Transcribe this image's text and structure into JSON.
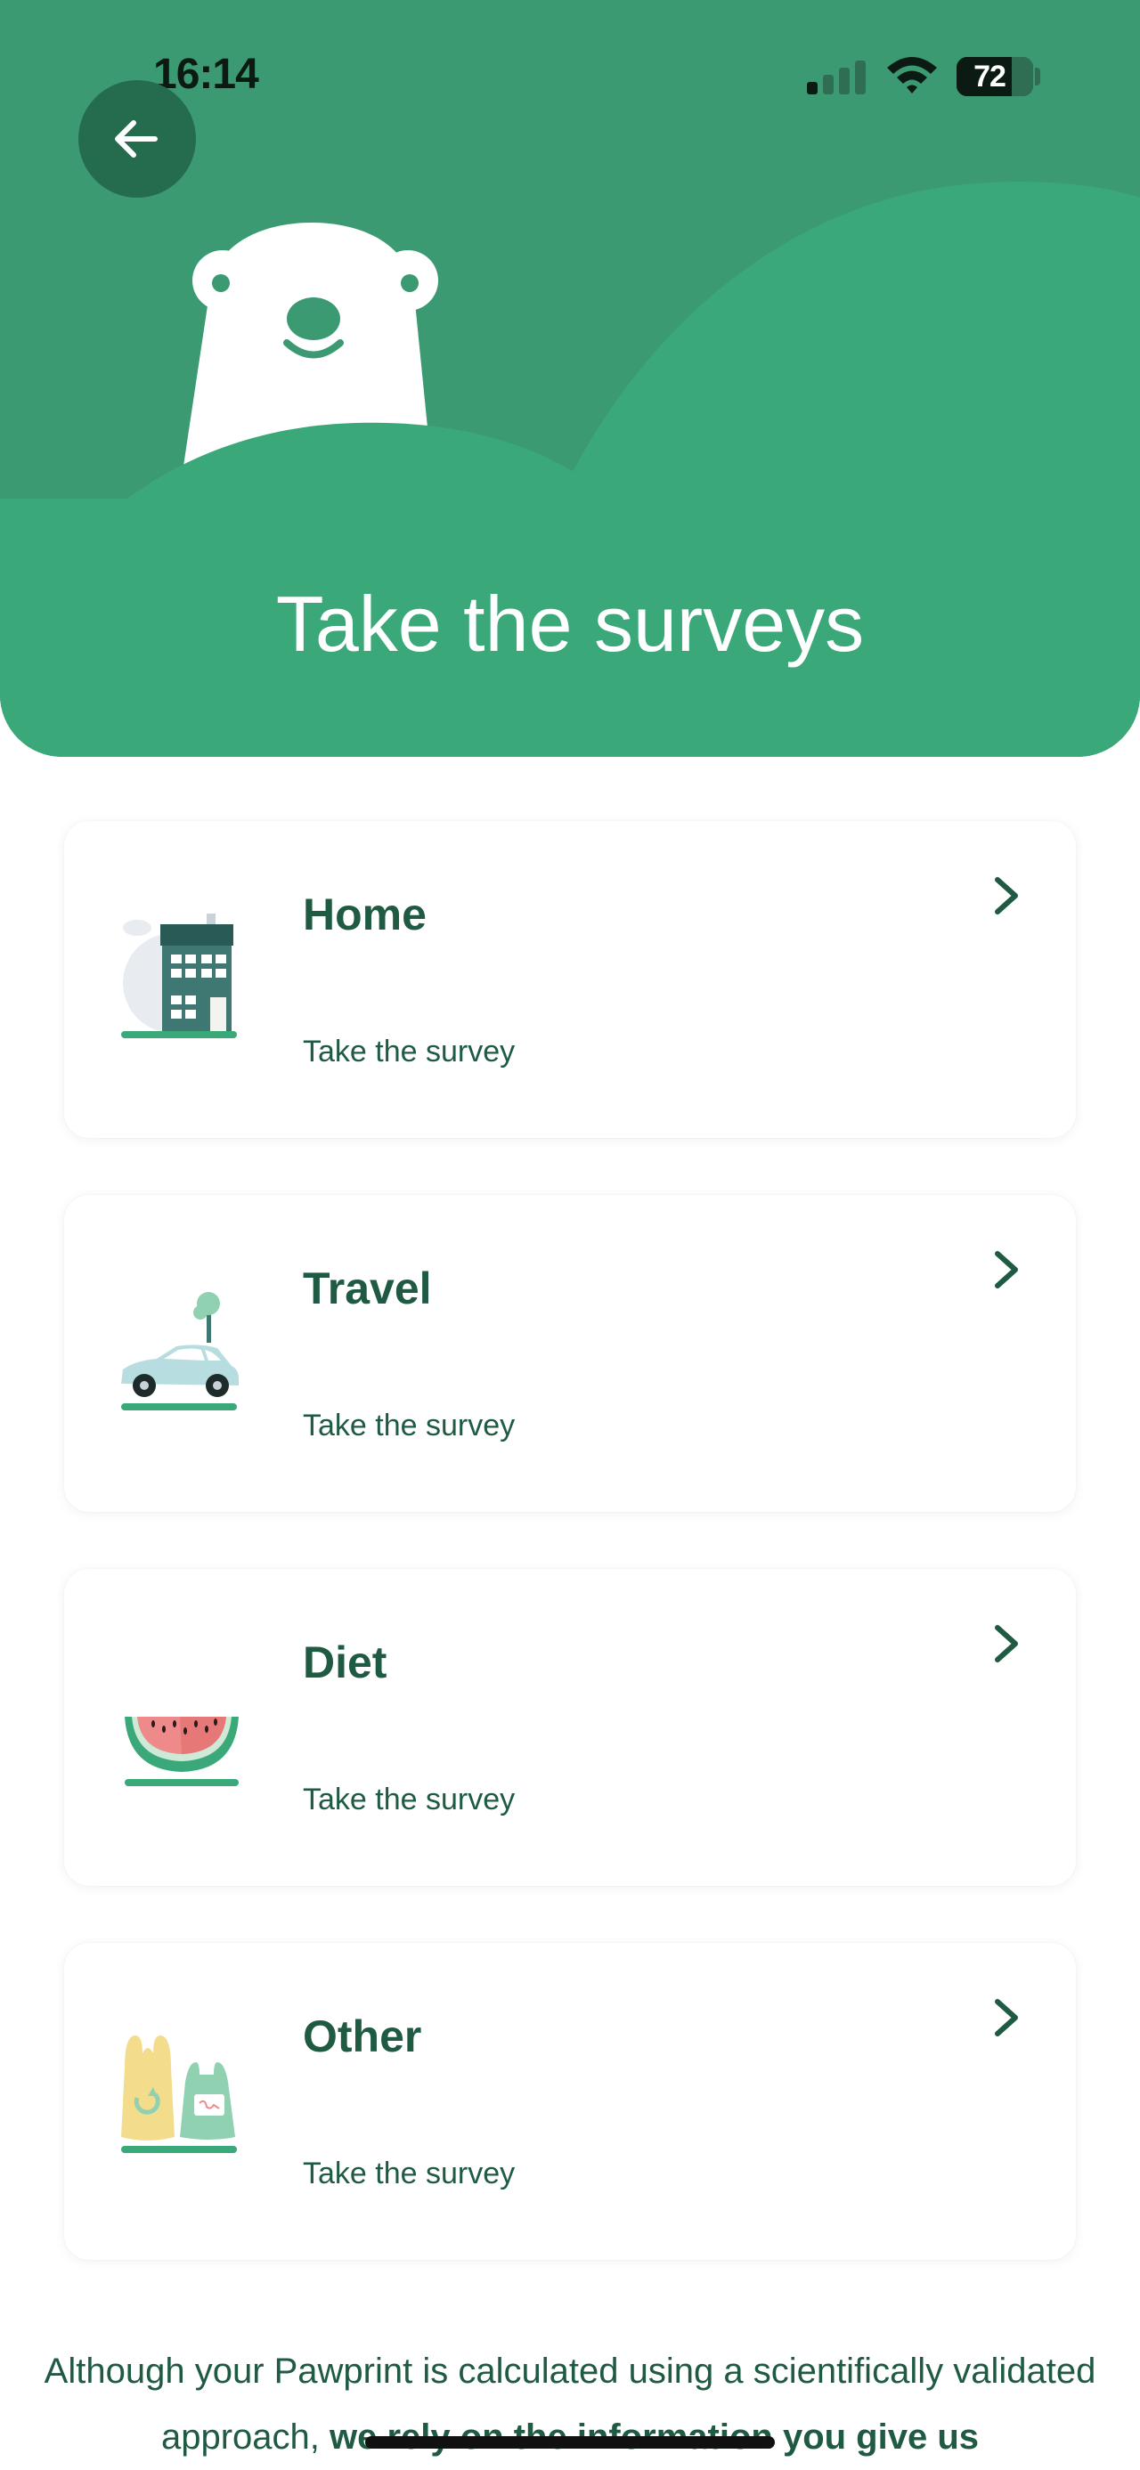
{
  "status_bar": {
    "time": "16:14",
    "battery": "72"
  },
  "header": {
    "back_icon": "arrow-left-icon",
    "title": "Take the surveys",
    "mascot": "polar-bear-mascot"
  },
  "surveys": [
    {
      "title": "Home",
      "subtitle": "Take the survey",
      "icon": "house-illustration"
    },
    {
      "title": "Travel",
      "subtitle": "Take the survey",
      "icon": "car-illustration"
    },
    {
      "title": "Diet",
      "subtitle": "Take the survey",
      "icon": "watermelon-illustration"
    },
    {
      "title": "Other",
      "subtitle": "Take the survey",
      "icon": "shopping-bags-illustration"
    }
  ],
  "footer": {
    "text_regular": "Although your Pawprint is calculated using a scientifically validated approach, ",
    "text_bold": "we rely on the information you give us"
  },
  "colors": {
    "hero_bg": "#3b9a72",
    "hill_front": "#3aa879",
    "back_button": "#256b4d",
    "text_primary": "#1f5a43",
    "accent_green": "#4aae7e"
  }
}
